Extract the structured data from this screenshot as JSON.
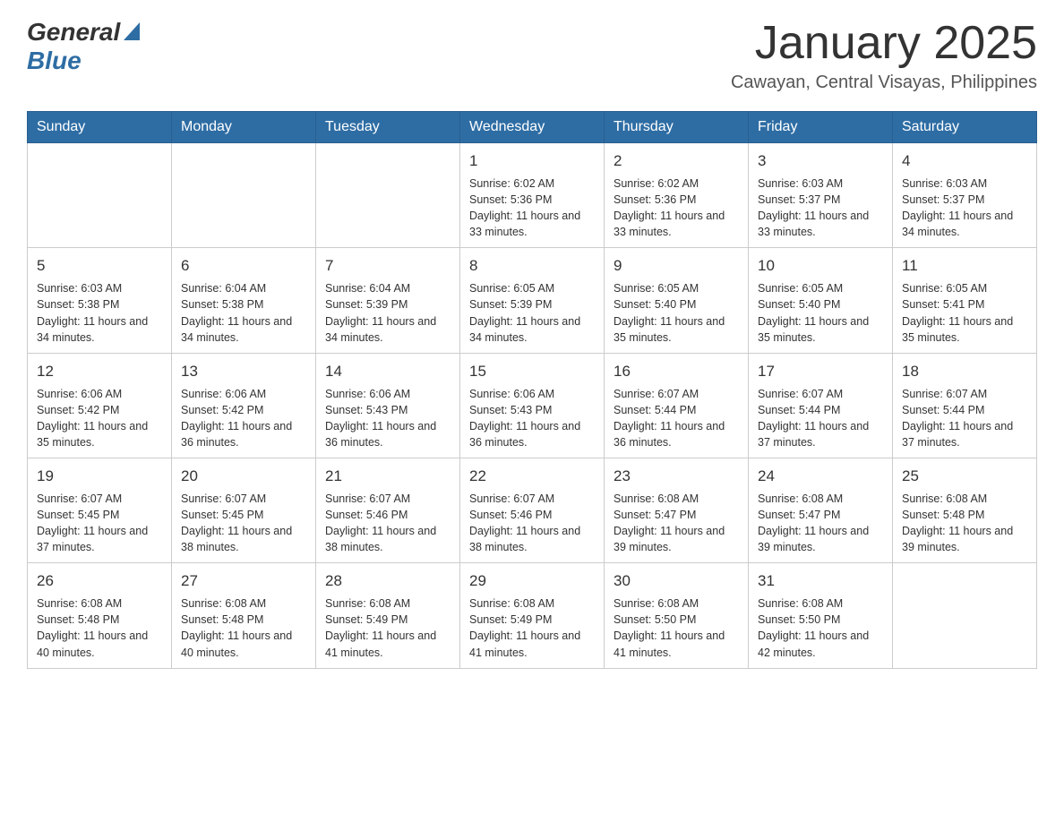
{
  "header": {
    "logo_general": "General",
    "logo_blue": "Blue",
    "calendar_title": "January 2025",
    "calendar_subtitle": "Cawayan, Central Visayas, Philippines"
  },
  "weekdays": [
    "Sunday",
    "Monday",
    "Tuesday",
    "Wednesday",
    "Thursday",
    "Friday",
    "Saturday"
  ],
  "weeks": [
    [
      {
        "day": "",
        "sunrise": "",
        "sunset": "",
        "daylight": ""
      },
      {
        "day": "",
        "sunrise": "",
        "sunset": "",
        "daylight": ""
      },
      {
        "day": "",
        "sunrise": "",
        "sunset": "",
        "daylight": ""
      },
      {
        "day": "1",
        "sunrise": "Sunrise: 6:02 AM",
        "sunset": "Sunset: 5:36 PM",
        "daylight": "Daylight: 11 hours and 33 minutes."
      },
      {
        "day": "2",
        "sunrise": "Sunrise: 6:02 AM",
        "sunset": "Sunset: 5:36 PM",
        "daylight": "Daylight: 11 hours and 33 minutes."
      },
      {
        "day": "3",
        "sunrise": "Sunrise: 6:03 AM",
        "sunset": "Sunset: 5:37 PM",
        "daylight": "Daylight: 11 hours and 33 minutes."
      },
      {
        "day": "4",
        "sunrise": "Sunrise: 6:03 AM",
        "sunset": "Sunset: 5:37 PM",
        "daylight": "Daylight: 11 hours and 34 minutes."
      }
    ],
    [
      {
        "day": "5",
        "sunrise": "Sunrise: 6:03 AM",
        "sunset": "Sunset: 5:38 PM",
        "daylight": "Daylight: 11 hours and 34 minutes."
      },
      {
        "day": "6",
        "sunrise": "Sunrise: 6:04 AM",
        "sunset": "Sunset: 5:38 PM",
        "daylight": "Daylight: 11 hours and 34 minutes."
      },
      {
        "day": "7",
        "sunrise": "Sunrise: 6:04 AM",
        "sunset": "Sunset: 5:39 PM",
        "daylight": "Daylight: 11 hours and 34 minutes."
      },
      {
        "day": "8",
        "sunrise": "Sunrise: 6:05 AM",
        "sunset": "Sunset: 5:39 PM",
        "daylight": "Daylight: 11 hours and 34 minutes."
      },
      {
        "day": "9",
        "sunrise": "Sunrise: 6:05 AM",
        "sunset": "Sunset: 5:40 PM",
        "daylight": "Daylight: 11 hours and 35 minutes."
      },
      {
        "day": "10",
        "sunrise": "Sunrise: 6:05 AM",
        "sunset": "Sunset: 5:40 PM",
        "daylight": "Daylight: 11 hours and 35 minutes."
      },
      {
        "day": "11",
        "sunrise": "Sunrise: 6:05 AM",
        "sunset": "Sunset: 5:41 PM",
        "daylight": "Daylight: 11 hours and 35 minutes."
      }
    ],
    [
      {
        "day": "12",
        "sunrise": "Sunrise: 6:06 AM",
        "sunset": "Sunset: 5:42 PM",
        "daylight": "Daylight: 11 hours and 35 minutes."
      },
      {
        "day": "13",
        "sunrise": "Sunrise: 6:06 AM",
        "sunset": "Sunset: 5:42 PM",
        "daylight": "Daylight: 11 hours and 36 minutes."
      },
      {
        "day": "14",
        "sunrise": "Sunrise: 6:06 AM",
        "sunset": "Sunset: 5:43 PM",
        "daylight": "Daylight: 11 hours and 36 minutes."
      },
      {
        "day": "15",
        "sunrise": "Sunrise: 6:06 AM",
        "sunset": "Sunset: 5:43 PM",
        "daylight": "Daylight: 11 hours and 36 minutes."
      },
      {
        "day": "16",
        "sunrise": "Sunrise: 6:07 AM",
        "sunset": "Sunset: 5:44 PM",
        "daylight": "Daylight: 11 hours and 36 minutes."
      },
      {
        "day": "17",
        "sunrise": "Sunrise: 6:07 AM",
        "sunset": "Sunset: 5:44 PM",
        "daylight": "Daylight: 11 hours and 37 minutes."
      },
      {
        "day": "18",
        "sunrise": "Sunrise: 6:07 AM",
        "sunset": "Sunset: 5:44 PM",
        "daylight": "Daylight: 11 hours and 37 minutes."
      }
    ],
    [
      {
        "day": "19",
        "sunrise": "Sunrise: 6:07 AM",
        "sunset": "Sunset: 5:45 PM",
        "daylight": "Daylight: 11 hours and 37 minutes."
      },
      {
        "day": "20",
        "sunrise": "Sunrise: 6:07 AM",
        "sunset": "Sunset: 5:45 PM",
        "daylight": "Daylight: 11 hours and 38 minutes."
      },
      {
        "day": "21",
        "sunrise": "Sunrise: 6:07 AM",
        "sunset": "Sunset: 5:46 PM",
        "daylight": "Daylight: 11 hours and 38 minutes."
      },
      {
        "day": "22",
        "sunrise": "Sunrise: 6:07 AM",
        "sunset": "Sunset: 5:46 PM",
        "daylight": "Daylight: 11 hours and 38 minutes."
      },
      {
        "day": "23",
        "sunrise": "Sunrise: 6:08 AM",
        "sunset": "Sunset: 5:47 PM",
        "daylight": "Daylight: 11 hours and 39 minutes."
      },
      {
        "day": "24",
        "sunrise": "Sunrise: 6:08 AM",
        "sunset": "Sunset: 5:47 PM",
        "daylight": "Daylight: 11 hours and 39 minutes."
      },
      {
        "day": "25",
        "sunrise": "Sunrise: 6:08 AM",
        "sunset": "Sunset: 5:48 PM",
        "daylight": "Daylight: 11 hours and 39 minutes."
      }
    ],
    [
      {
        "day": "26",
        "sunrise": "Sunrise: 6:08 AM",
        "sunset": "Sunset: 5:48 PM",
        "daylight": "Daylight: 11 hours and 40 minutes."
      },
      {
        "day": "27",
        "sunrise": "Sunrise: 6:08 AM",
        "sunset": "Sunset: 5:48 PM",
        "daylight": "Daylight: 11 hours and 40 minutes."
      },
      {
        "day": "28",
        "sunrise": "Sunrise: 6:08 AM",
        "sunset": "Sunset: 5:49 PM",
        "daylight": "Daylight: 11 hours and 41 minutes."
      },
      {
        "day": "29",
        "sunrise": "Sunrise: 6:08 AM",
        "sunset": "Sunset: 5:49 PM",
        "daylight": "Daylight: 11 hours and 41 minutes."
      },
      {
        "day": "30",
        "sunrise": "Sunrise: 6:08 AM",
        "sunset": "Sunset: 5:50 PM",
        "daylight": "Daylight: 11 hours and 41 minutes."
      },
      {
        "day": "31",
        "sunrise": "Sunrise: 6:08 AM",
        "sunset": "Sunset: 5:50 PM",
        "daylight": "Daylight: 11 hours and 42 minutes."
      },
      {
        "day": "",
        "sunrise": "",
        "sunset": "",
        "daylight": ""
      }
    ]
  ]
}
